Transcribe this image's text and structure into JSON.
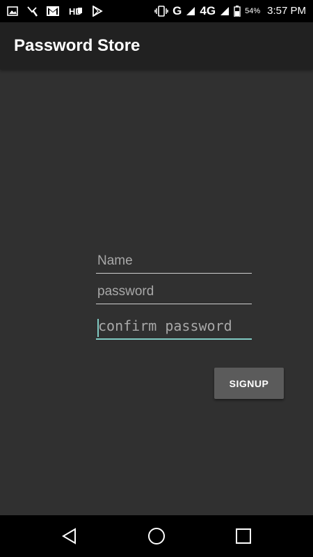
{
  "status_bar": {
    "left_icons": [
      "image-icon",
      "missed-call-icon",
      "gmail-icon",
      "hd-icon",
      "play-store-icon"
    ],
    "right_icons": [
      "vibrate-icon",
      "signal-icon",
      "signal-4g-icon",
      "battery-icon"
    ],
    "network_g": "G",
    "network_4g": "4G",
    "battery": "54%",
    "time": "3:57 PM"
  },
  "app_bar": {
    "title": "Password Store"
  },
  "form": {
    "name_placeholder": "Name",
    "password_placeholder": "password",
    "confirm_placeholder": "confirm password",
    "signup_label": "SIGNUP",
    "accent_color": "#80cbc4"
  },
  "nav_bar": {
    "buttons": [
      "back-icon",
      "home-icon",
      "recents-icon"
    ]
  },
  "colors": {
    "background": "#303030",
    "app_bar": "#212121",
    "button": "#5b5b5b"
  }
}
